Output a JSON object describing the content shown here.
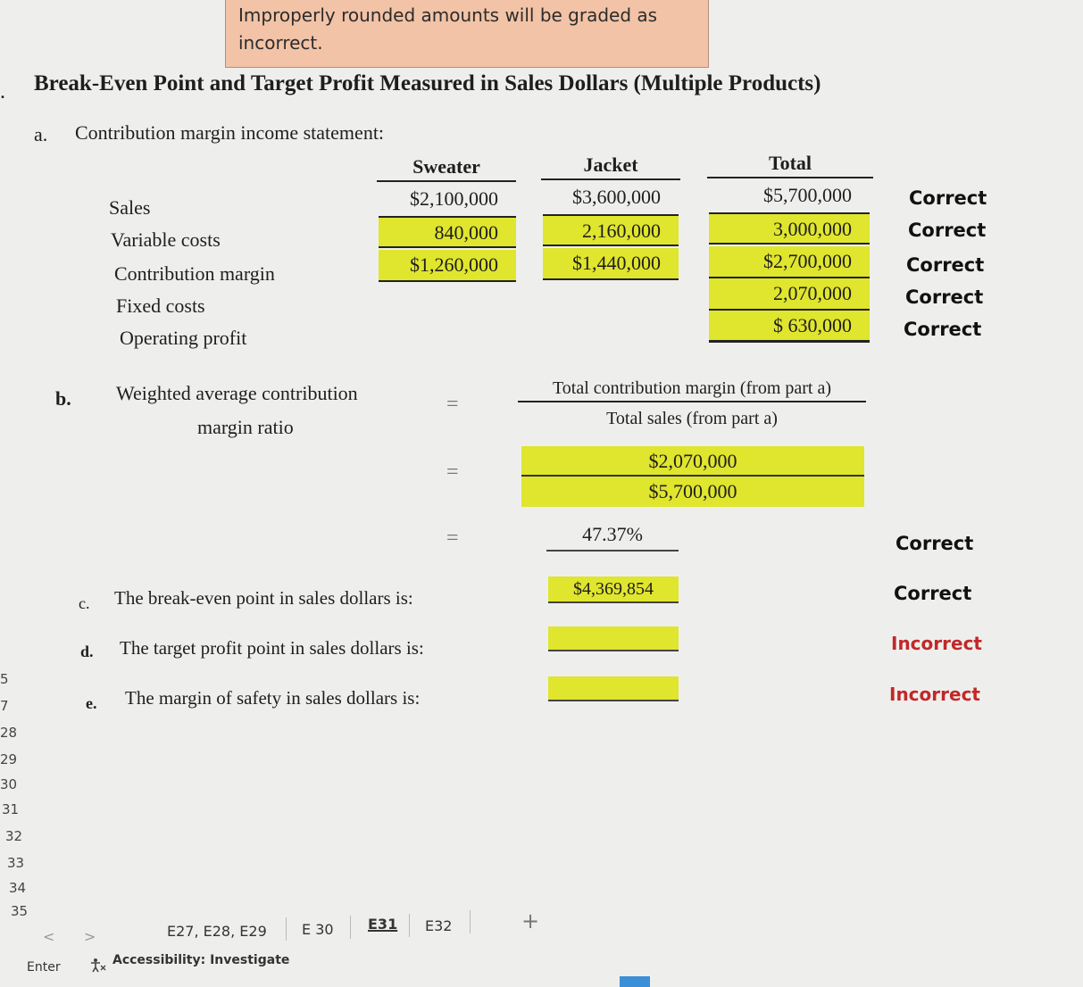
{
  "note": {
    "text": "Improperly rounded amounts will be graded as incorrect."
  },
  "title": "Break-Even Point and Target Profit Measured in Sales Dollars (Multiple Products)",
  "part_a": {
    "letter": "a.",
    "label": "Contribution margin income statement:",
    "columns": [
      "Sweater",
      "Jacket",
      "Total"
    ],
    "rows": [
      "Sales",
      "Variable costs",
      "Contribution margin",
      "Fixed costs",
      "Operating profit"
    ],
    "sweater": [
      "$2,100,000",
      "840,000",
      "$1,260,000"
    ],
    "jacket": [
      "$3,600,000",
      "2,160,000",
      "$1,440,000"
    ],
    "total": [
      "$5,700,000",
      "3,000,000",
      "$2,700,000",
      "2,070,000",
      "$ 630,000"
    ],
    "status": [
      "Correct",
      "Correct",
      "Correct",
      "Correct",
      "Correct"
    ]
  },
  "part_b": {
    "letter": "b.",
    "label_line1": "Weighted average contribution",
    "label_line2": "margin ratio",
    "eq": "=",
    "formula_num": "Total contribution margin (from part a)",
    "formula_den": "Total sales (from part a)",
    "input_num": "$2,070,000",
    "input_den": "$5,700,000",
    "result": "47.37%",
    "status": "Correct"
  },
  "part_c": {
    "letter": "c.",
    "label": "The break-even point in sales dollars is:",
    "value": "$4,369,854",
    "status": "Correct"
  },
  "part_d": {
    "letter": "d.",
    "label": "The target profit point in sales dollars is:",
    "value": "",
    "status": "Incorrect"
  },
  "part_e": {
    "letter": "e.",
    "label": "The margin of safety in sales dollars is:",
    "value": "",
    "status": "Incorrect"
  },
  "row_numbers": [
    "5",
    "7",
    "28",
    "29",
    "30",
    "31",
    "32",
    "33",
    "34",
    "35"
  ],
  "sheet_tabs": [
    "E27, E28, E29",
    "E 30",
    "E31",
    "E32"
  ],
  "active_tab": "E31",
  "add_sheet": "+",
  "nav_prev": "<",
  "nav_next": ">",
  "status_bar": {
    "mode": "Enter",
    "accessibility": "Accessibility: Investigate"
  }
}
